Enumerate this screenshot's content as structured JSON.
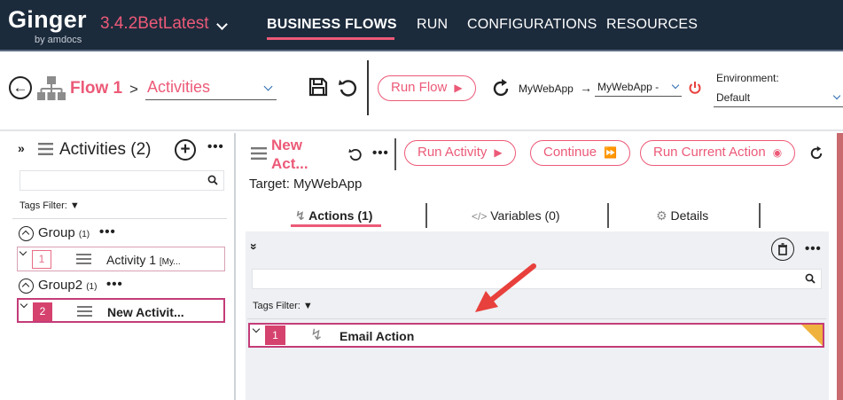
{
  "app": {
    "logo": "Ginger",
    "logo_sub": "by amdocs",
    "version": "3.4.2BetLatest"
  },
  "nav": {
    "items": [
      "BUSINESS FLOWS",
      "RUN",
      "CONFIGURATIONS",
      "RESOURCES"
    ],
    "active": "BUSINESS FLOWS"
  },
  "toolbar": {
    "flow_name": "Flow 1",
    "breadcrumb_sep": ">",
    "view_select": "Activities",
    "run_flow_label": "Run Flow",
    "app_label": "MyWebApp",
    "app_select": "MyWebApp -",
    "environment_label": "Environment:",
    "environment_value": "Default"
  },
  "activities_panel": {
    "title": "Activities  (2)",
    "tags_filter_label": "Tags Filter:",
    "groups": [
      {
        "name": "Group",
        "count": "(1)",
        "activities": [
          {
            "index": "1",
            "name": "Activity 1",
            "suffix": "[My..."
          }
        ]
      },
      {
        "name": "Group2",
        "count": "(1)",
        "activities": [
          {
            "index": "2",
            "name": "New Activit...",
            "suffix": ""
          }
        ]
      }
    ]
  },
  "activity_editor": {
    "title_line1": "New",
    "title_line2": "Act...",
    "run_activity_label": "Run Activity",
    "continue_label": "Continue",
    "run_current_action_label": "Run Current Action",
    "target_text": "Target: MyWebApp",
    "tabs": [
      {
        "label": "Actions (1)",
        "active": true,
        "icon": "lightning-icon"
      },
      {
        "label": "Variables (0)",
        "active": false,
        "icon": "code-icon"
      },
      {
        "label": "Details",
        "active": false,
        "icon": "gear-icon"
      }
    ],
    "tags_filter_label": "Tags Filter:",
    "actions": [
      {
        "index": "1",
        "name": "Email Action"
      }
    ]
  },
  "colors": {
    "brand_pink": "#ec5a78",
    "nav_bg": "#1c2b3c",
    "selection": "#c43c78",
    "annotation_arrow": "#e8403c"
  }
}
